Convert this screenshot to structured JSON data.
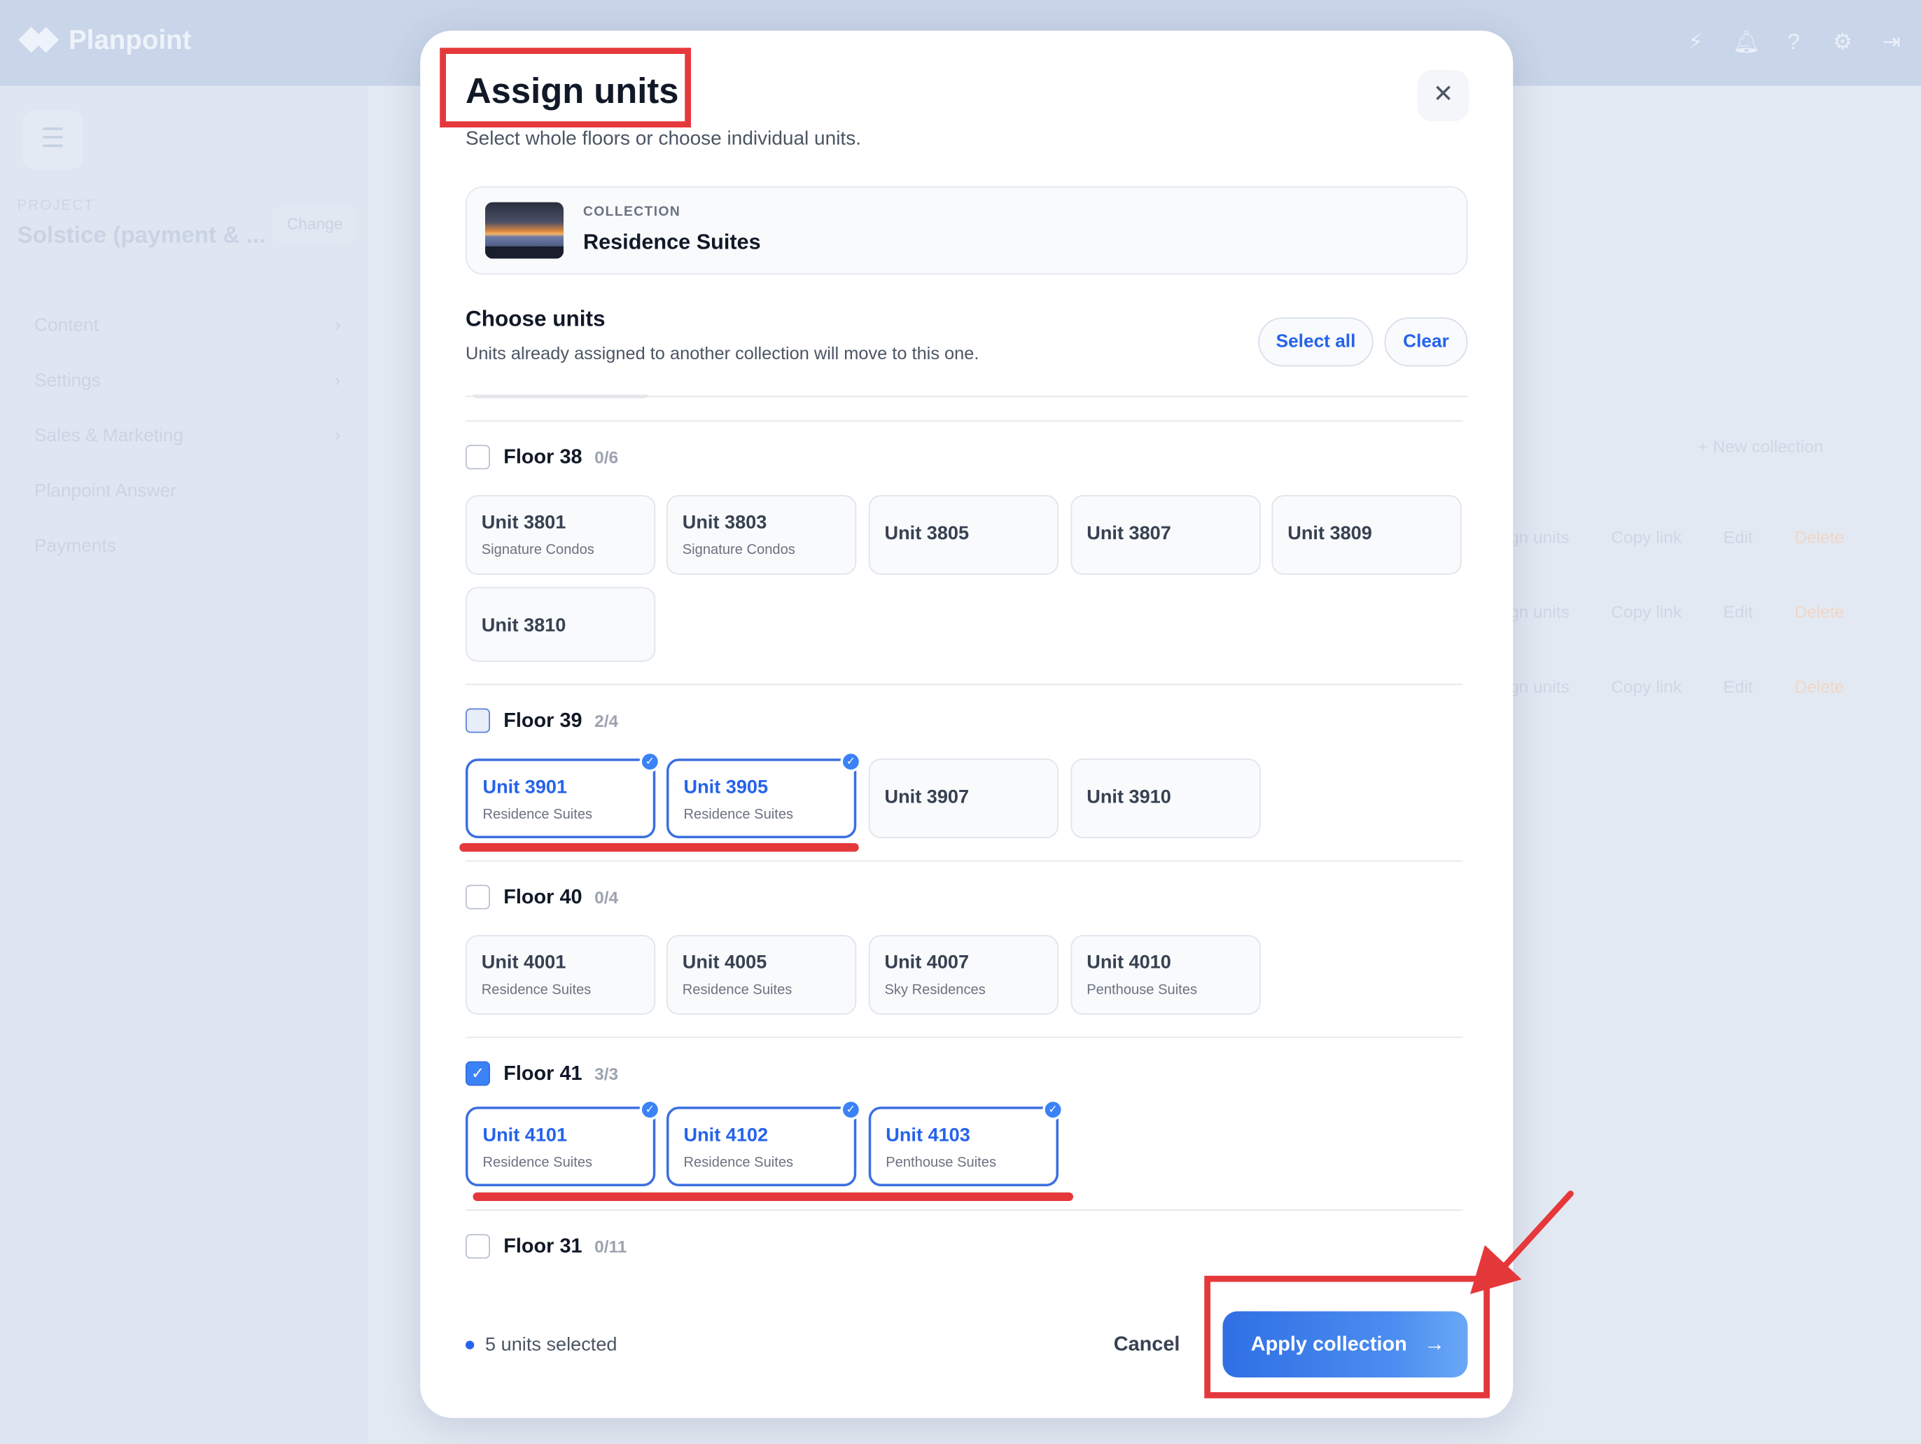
{
  "background": {
    "brand": "Planpoint",
    "top_icons": [
      "bolt-icon",
      "bell-icon",
      "help-icon",
      "gear-icon",
      "logout-icon"
    ],
    "project_label": "PROJECT",
    "project_name": "Solstice (payment & ...",
    "change_label": "Change",
    "nav": [
      "Content",
      "Settings",
      "Sales & Marketing",
      "Planpoint Answer",
      "Payments"
    ],
    "new_collection": "+ New collection",
    "row_actions": {
      "assign": "gn units",
      "copy": "Copy link",
      "edit": "Edit",
      "delete": "Delete"
    }
  },
  "modal": {
    "title": "Assign units",
    "subtitle": "Select whole floors or choose individual units.",
    "close_icon": "close-icon",
    "collection": {
      "label": "COLLECTION",
      "name": "Residence Suites"
    },
    "choose_title": "Choose units",
    "choose_subtitle": "Units already assigned to another collection will move to this one.",
    "select_all": "Select all",
    "clear": "Clear",
    "floors": [
      {
        "name": "Floor 38",
        "count": "0/6",
        "state": "unchecked",
        "units": [
          {
            "name": "Unit 3801",
            "collection": "Signature Condos",
            "selected": false
          },
          {
            "name": "Unit 3803",
            "collection": "Signature Condos",
            "selected": false
          },
          {
            "name": "Unit 3805",
            "collection": "",
            "selected": false
          },
          {
            "name": "Unit 3807",
            "collection": "",
            "selected": false
          },
          {
            "name": "Unit 3809",
            "collection": "",
            "selected": false
          },
          {
            "name": "Unit 3810",
            "collection": "",
            "selected": false
          }
        ]
      },
      {
        "name": "Floor 39",
        "count": "2/4",
        "state": "partial",
        "units": [
          {
            "name": "Unit 3901",
            "collection": "Residence Suites",
            "selected": true
          },
          {
            "name": "Unit 3905",
            "collection": "Residence Suites",
            "selected": true
          },
          {
            "name": "Unit 3907",
            "collection": "",
            "selected": false
          },
          {
            "name": "Unit 3910",
            "collection": "",
            "selected": false
          }
        ]
      },
      {
        "name": "Floor 40",
        "count": "0/4",
        "state": "unchecked",
        "units": [
          {
            "name": "Unit 4001",
            "collection": "Residence Suites",
            "selected": false
          },
          {
            "name": "Unit 4005",
            "collection": "Residence Suites",
            "selected": false
          },
          {
            "name": "Unit 4007",
            "collection": "Sky Residences",
            "selected": false
          },
          {
            "name": "Unit 4010",
            "collection": "Penthouse Suites",
            "selected": false
          }
        ]
      },
      {
        "name": "Floor 41",
        "count": "3/3",
        "state": "checked",
        "units": [
          {
            "name": "Unit 4101",
            "collection": "Residence Suites",
            "selected": true
          },
          {
            "name": "Unit 4102",
            "collection": "Residence Suites",
            "selected": true
          },
          {
            "name": "Unit 4103",
            "collection": "Penthouse Suites",
            "selected": true
          }
        ]
      },
      {
        "name": "Floor 31",
        "count": "0/11",
        "state": "unchecked",
        "units": []
      }
    ],
    "selected_summary": "5 units selected",
    "cancel": "Cancel",
    "apply": "Apply collection",
    "apply_icon": "arrow-right-icon"
  },
  "colors": {
    "accent": "#2563eb",
    "annotation": "#e5383b"
  }
}
